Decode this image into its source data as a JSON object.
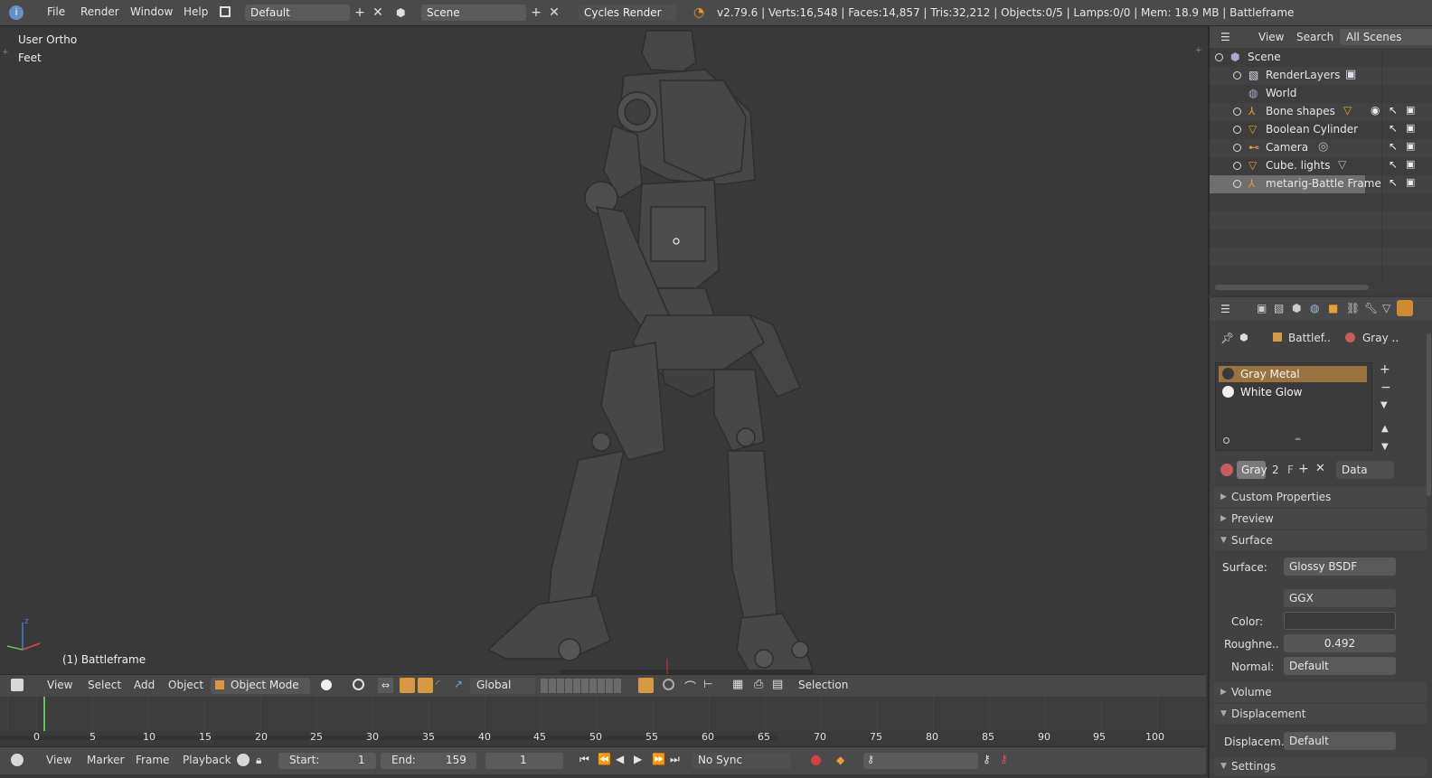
{
  "top": {
    "menus": [
      "File",
      "Render",
      "Window",
      "Help"
    ],
    "screen_layout": "Default",
    "scene": "Scene",
    "render_engine": "Cycles Render",
    "stats": "v2.79.6 | Verts:16,548 | Faces:14,857 | Tris:32,212 | Objects:0/5 | Lamps:0/0 | Mem: 18.9 MB | Battleframe"
  },
  "viewport": {
    "view_name": "User Ortho",
    "units": "Feet",
    "object_label": "(1) Battleframe"
  },
  "view3d_header": {
    "menus": [
      "View",
      "Select",
      "Add",
      "Object"
    ],
    "mode": "Object Mode",
    "orientation": "Global",
    "status": "Selection"
  },
  "timeline": {
    "ticks": [
      "0",
      "5",
      "10",
      "15",
      "20",
      "25",
      "30",
      "35",
      "40",
      "45",
      "50",
      "55",
      "60",
      "65",
      "70",
      "75",
      "80",
      "85",
      "90",
      "95",
      "100"
    ],
    "menus": [
      "View",
      "Marker",
      "Frame",
      "Playback"
    ],
    "start_label": "Start:",
    "start_value": "1",
    "end_label": "End:",
    "end_value": "159",
    "current_frame": "1",
    "sync": "No Sync"
  },
  "outliner": {
    "tabs": [
      "View",
      "Search",
      "All Scenes"
    ],
    "items": [
      {
        "label": "Scene"
      },
      {
        "label": "RenderLayers"
      },
      {
        "label": "World"
      },
      {
        "label": "Bone shapes"
      },
      {
        "label": "Boolean Cylinder"
      },
      {
        "label": "Camera"
      },
      {
        "label": "Cube. lights"
      },
      {
        "label": "metarig-Battle Frame",
        "selected": true
      }
    ]
  },
  "properties": {
    "breadcrumb_object": "Battlef..",
    "breadcrumb_material": "Gray ..",
    "material_slots": [
      "Gray Metal",
      "White Glow"
    ],
    "material_name": "Gray",
    "users": "2",
    "fake_user": "F",
    "link": "Data",
    "panels": {
      "custom_properties": "Custom Properties",
      "preview": "Preview",
      "surface": "Surface",
      "volume": "Volume",
      "displacement": "Displacement",
      "settings": "Settings"
    },
    "surface_label": "Surface:",
    "surface_value": "Glossy BSDF",
    "distribution": "GGX",
    "color_label": "Color:",
    "roughness_label": "Roughne..",
    "roughness_value": "0.492",
    "normal_label": "Normal:",
    "normal_value": "Default",
    "displacement_label": "Displacem..",
    "displacement_value": "Default"
  },
  "colors": {
    "selected_slot": "#9a7440",
    "timeline_cursor": "#59c45e",
    "outliner_selected": "#7a7a7a"
  }
}
